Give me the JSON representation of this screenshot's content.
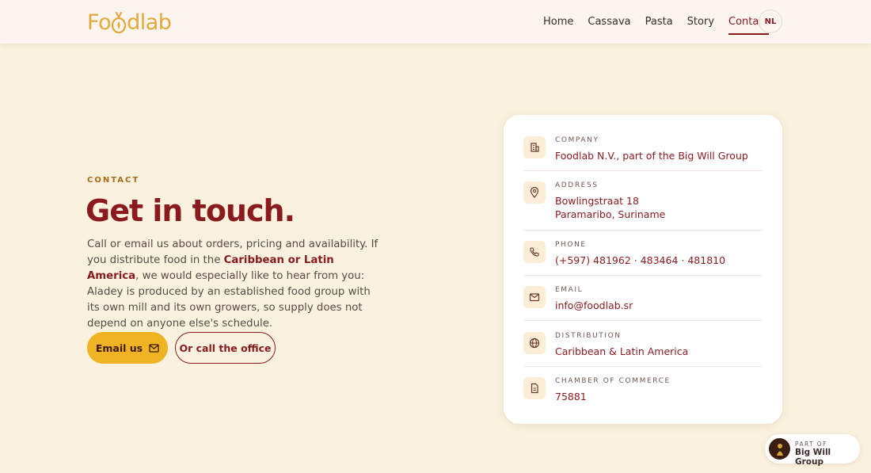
{
  "header": {
    "logo_text_1": "Fo",
    "logo_text_2": "dlab",
    "nav": [
      {
        "label": "Home"
      },
      {
        "label": "Cassava"
      },
      {
        "label": "Pasta"
      },
      {
        "label": "Story"
      },
      {
        "label": "Contact",
        "active": true
      }
    ],
    "language": "NL"
  },
  "hero": {
    "eyebrow": "CONTACT",
    "title": "Get in touch.",
    "body_part1": "Call or email us about orders, pricing and availability. If you distribute food in the ",
    "body_highlight": "Caribbean or Latin America",
    "body_part2": ", we would especially like to hear from you: Aladey is produced by an established food group with its own mill and its own growers, so supply does not depend on anyone else's schedule.",
    "primary_button": "Email us",
    "secondary_button": "Or call the office"
  },
  "contact_card": {
    "rows": [
      {
        "label": "COMPANY",
        "value": "Foodlab N.V., part of the Big Will Group",
        "icon": "building-icon"
      },
      {
        "label": "ADDRESS",
        "value": "Bowlingstraat 18",
        "value2": "Paramaribo, Suriname",
        "icon": "map-pin-icon"
      },
      {
        "label": "PHONE",
        "value": "(+597) 481962 · 483464 · 481810",
        "icon": "phone-icon"
      },
      {
        "label": "EMAIL",
        "value": "info@foodlab.sr",
        "icon": "mail-icon"
      },
      {
        "label": "DISTRIBUTION",
        "value": "Caribbean & Latin America",
        "icon": "globe-icon"
      },
      {
        "label": "CHAMBER OF COMMERCE",
        "value": "75881",
        "icon": "document-icon"
      }
    ]
  },
  "badge": {
    "sub": "PART OF",
    "main": "Big Will Group"
  },
  "colors": {
    "background": "#faf1de",
    "brand_red": "#8b1a1f",
    "brand_yellow": "#f0b323",
    "logo_gold": "#e2a93b"
  }
}
